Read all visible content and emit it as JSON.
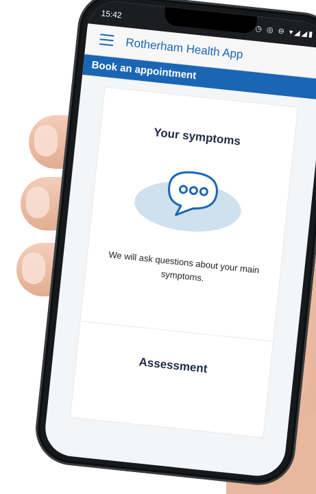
{
  "status": {
    "time": "15:42",
    "icons": "◷ ◎ ⊖ ▾◢◢▮"
  },
  "app": {
    "title": "Rotherham Health App",
    "menu_icon": "hamburger-icon"
  },
  "subheader": {
    "title": "Book an appointment"
  },
  "cards": [
    {
      "title": "Your symptoms",
      "body": "We will ask questions about your main symptoms.",
      "icon": "speech-bubble-icon"
    },
    {
      "title": "Assessment"
    }
  ],
  "colors": {
    "primary": "#1a66b5",
    "illustration_bg": "#cfe0ef"
  }
}
